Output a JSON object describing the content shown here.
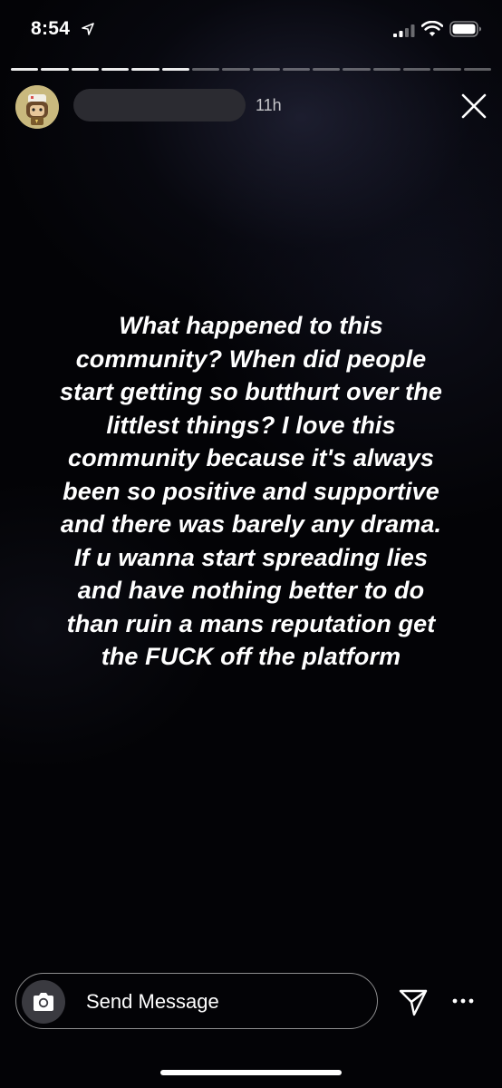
{
  "status_bar": {
    "time": "8:54",
    "icons": [
      "location-arrow-icon",
      "signal-icon",
      "wifi-icon",
      "battery-icon"
    ]
  },
  "story": {
    "progress": {
      "segments": 16,
      "viewed": 6
    },
    "age": "11h",
    "text": "What happened to this community? When did people start getting so butthurt over the littlest things? I love this community because it's always been so positive and supportive and there was barely any drama. If u wanna start spreading lies and have nothing better to do than ruin a mans reputation get the FUCK off the platform"
  },
  "footer": {
    "message_placeholder": "Send Message",
    "icons": [
      "camera-icon",
      "send-icon",
      "more-icon"
    ]
  },
  "colors": {
    "background": "#030306",
    "text": "#ffffff",
    "redaction": "#2b2b31",
    "avatar": "#c9b97e"
  }
}
